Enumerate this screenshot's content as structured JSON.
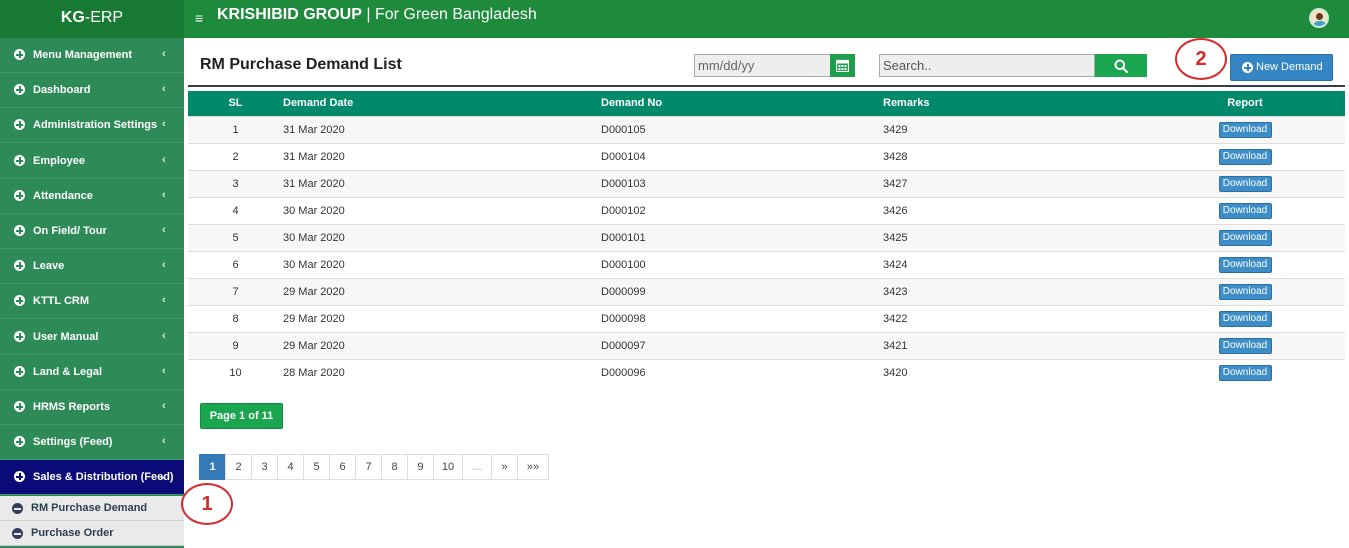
{
  "header": {
    "brand_bold": "KG",
    "brand_rest": "-ERP",
    "hamburger": "≡",
    "org": "KRISHIBID GROUP",
    "separator": " | ",
    "tagline": "For Green Bangladesh"
  },
  "sidebar": {
    "items": [
      {
        "label": "Menu Management"
      },
      {
        "label": "Dashboard"
      },
      {
        "label": "Administration Settings"
      },
      {
        "label": "Employee"
      },
      {
        "label": "Attendance"
      },
      {
        "label": "On Field/ Tour"
      },
      {
        "label": "Leave"
      },
      {
        "label": "KTTL CRM"
      },
      {
        "label": "User Manual"
      },
      {
        "label": "Land & Legal"
      },
      {
        "label": "HRMS Reports"
      },
      {
        "label": "Settings (Feed)"
      },
      {
        "label": "Sales & Distribution (Feed)"
      }
    ],
    "subitems": [
      {
        "label": "RM Purchase Demand"
      },
      {
        "label": "Purchase Order"
      }
    ],
    "chevron_collapsed": "‹",
    "chevron_expanded": "⌄"
  },
  "markers": {
    "one": "1",
    "two": "2"
  },
  "main": {
    "title": "RM Purchase Demand List",
    "date_placeholder": "mm/dd/yy",
    "search_placeholder": "Search..",
    "new_button": "New Demand",
    "columns": [
      "SL",
      "Demand Date",
      "Demand No",
      "Remarks",
      "Report"
    ],
    "download_label": "Download",
    "rows": [
      {
        "sl": "1",
        "date": "31 Mar 2020",
        "no": "D000105",
        "remarks": "3429"
      },
      {
        "sl": "2",
        "date": "31 Mar 2020",
        "no": "D000104",
        "remarks": "3428"
      },
      {
        "sl": "3",
        "date": "31 Mar 2020",
        "no": "D000103",
        "remarks": "3427"
      },
      {
        "sl": "4",
        "date": "30 Mar 2020",
        "no": "D000102",
        "remarks": "3426"
      },
      {
        "sl": "5",
        "date": "30 Mar 2020",
        "no": "D000101",
        "remarks": "3425"
      },
      {
        "sl": "6",
        "date": "30 Mar 2020",
        "no": "D000100",
        "remarks": "3424"
      },
      {
        "sl": "7",
        "date": "29 Mar 2020",
        "no": "D000099",
        "remarks": "3423"
      },
      {
        "sl": "8",
        "date": "29 Mar 2020",
        "no": "D000098",
        "remarks": "3422"
      },
      {
        "sl": "9",
        "date": "29 Mar 2020",
        "no": "D000097",
        "remarks": "3421"
      },
      {
        "sl": "10",
        "date": "28 Mar 2020",
        "no": "D000096",
        "remarks": "3420"
      }
    ],
    "page_info": "Page 1 of 11",
    "pager": [
      "1",
      "2",
      "3",
      "4",
      "5",
      "6",
      "7",
      "8",
      "9",
      "10",
      "...",
      "»",
      "»»"
    ]
  },
  "colors": {
    "topbar": "#1e8a3c",
    "sidebar": "#2e8b57",
    "sidebar_active": "#0a0a78",
    "table_header": "#00896a",
    "primary_button": "#3386c3",
    "success_button": "#1aa54f",
    "marker": "#d62b2b"
  },
  "icons": {
    "menu": "hamburger-icon",
    "calendar": "calendar-icon",
    "search": "search-icon",
    "new": "plus-circle-icon",
    "sidebar_bullet": "plus-circle-icon",
    "sub_bullet": "minus-circle-icon",
    "user": "avatar"
  }
}
